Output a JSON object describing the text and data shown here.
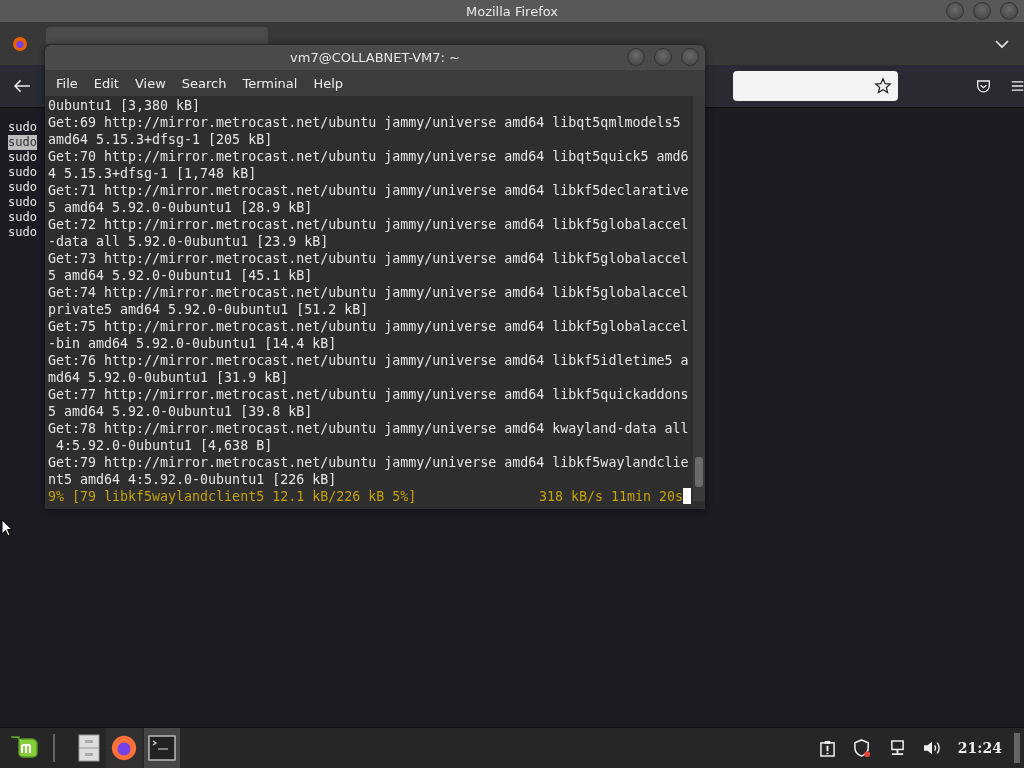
{
  "browser": {
    "title": "Mozilla Firefox",
    "content_lines": [
      {
        "text": "sudo",
        "selected": false
      },
      {
        "text": "sudo",
        "selected": true
      },
      {
        "text": "sudo",
        "selected": false
      },
      {
        "text": "sudo",
        "selected": false
      },
      {
        "text": "sudo",
        "selected": false
      },
      {
        "text": "sudo",
        "selected": false
      },
      {
        "text": "sudo",
        "selected": false
      },
      {
        "text": "sudo",
        "selected": false
      }
    ]
  },
  "terminal": {
    "title": "vm7@COLLABNET-VM7: ~",
    "menu": [
      "File",
      "Edit",
      "View",
      "Search",
      "Terminal",
      "Help"
    ],
    "lines": [
      "0ubuntu1 [3,380 kB]",
      "Get:69 http://mirror.metrocast.net/ubuntu jammy/universe amd64 libqt5qmlmodels5",
      "amd64 5.15.3+dfsg-1 [205 kB]",
      "Get:70 http://mirror.metrocast.net/ubuntu jammy/universe amd64 libqt5quick5 amd6",
      "4 5.15.3+dfsg-1 [1,748 kB]",
      "Get:71 http://mirror.metrocast.net/ubuntu jammy/universe amd64 libkf5declarative",
      "5 amd64 5.92.0-0ubuntu1 [28.9 kB]",
      "Get:72 http://mirror.metrocast.net/ubuntu jammy/universe amd64 libkf5globalaccel",
      "-data all 5.92.0-0ubuntu1 [23.9 kB]",
      "Get:73 http://mirror.metrocast.net/ubuntu jammy/universe amd64 libkf5globalaccel",
      "5 amd64 5.92.0-0ubuntu1 [45.1 kB]",
      "Get:74 http://mirror.metrocast.net/ubuntu jammy/universe amd64 libkf5globalaccel",
      "private5 amd64 5.92.0-0ubuntu1 [51.2 kB]",
      "Get:75 http://mirror.metrocast.net/ubuntu jammy/universe amd64 libkf5globalaccel",
      "-bin amd64 5.92.0-0ubuntu1 [14.4 kB]",
      "Get:76 http://mirror.metrocast.net/ubuntu jammy/universe amd64 libkf5idletime5 a",
      "md64 5.92.0-0ubuntu1 [31.9 kB]",
      "Get:77 http://mirror.metrocast.net/ubuntu jammy/universe amd64 libkf5quickaddons",
      "5 amd64 5.92.0-0ubuntu1 [39.8 kB]",
      "Get:78 http://mirror.metrocast.net/ubuntu jammy/universe amd64 kwayland-data all",
      " 4:5.92.0-0ubuntu1 [4,638 B]",
      "Get:79 http://mirror.metrocast.net/ubuntu jammy/universe amd64 libkf5waylandclie",
      "nt5 amd64 4:5.92.0-0ubuntu1 [226 kB]"
    ],
    "status_left": "9% [79 libkf5waylandclient5 12.1 kB/226 kB 5%]",
    "status_right": "318 kB/s 11min 20s"
  },
  "taskbar": {
    "clock": "21:24"
  }
}
